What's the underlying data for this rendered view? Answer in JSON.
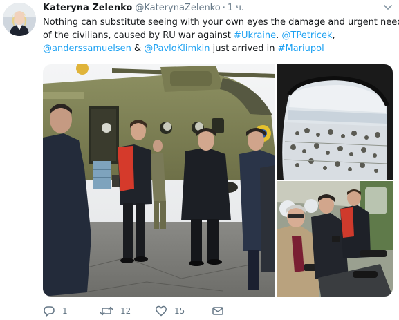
{
  "author": {
    "name": "Kateryna Zelenko",
    "handle": "@KaterynaZelenko",
    "separator": "·",
    "time": "1 ч."
  },
  "tweet": {
    "line1": "Nothing can substitute seeing with your own eyes the damage and urgent need",
    "line2_text": "of the civilians, caused by RU war against ",
    "line2_hashtag": "#Ukraine",
    "line2_sep": ". ",
    "line2_mention": "@TPetricek",
    "line2_end": ",",
    "line3_mention1": "@anderssamuelsen",
    "line3_amp": " & ",
    "line3_mention2": "@PavloKlimkin",
    "line3_text": " just arrived in ",
    "line3_hashtag": "#Mariupol"
  },
  "actions": {
    "reply_count": "1",
    "retweet_count": "12",
    "like_count": "15"
  },
  "colors": {
    "link": "#1da1f2",
    "secondary_text": "#657786",
    "primary_text": "#14171a"
  },
  "icons": [
    "caret-down-icon",
    "reply-icon",
    "retweet-icon",
    "like-icon",
    "message-icon"
  ]
}
